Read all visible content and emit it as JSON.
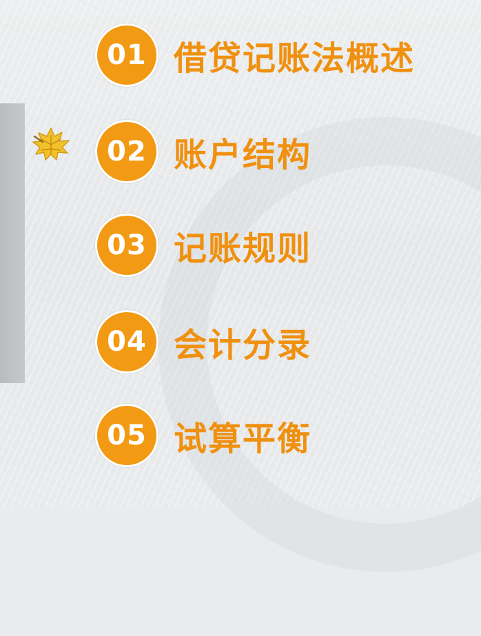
{
  "menu": {
    "items": [
      {
        "number": "01",
        "label": "借贷记账法概述"
      },
      {
        "number": "02",
        "label": "账户结构"
      },
      {
        "number": "03",
        "label": "记账规则"
      },
      {
        "number": "04",
        "label": "会计分录"
      },
      {
        "number": "05",
        "label": "试算平衡"
      }
    ],
    "active_index": 1
  },
  "decorations": {
    "pointer_icon": "maple-leaf-icon"
  },
  "colors": {
    "accent": "#f39a14",
    "label_text": "#f0900f",
    "background": "#e9ebec",
    "side_bar": "#c0c3c6"
  }
}
